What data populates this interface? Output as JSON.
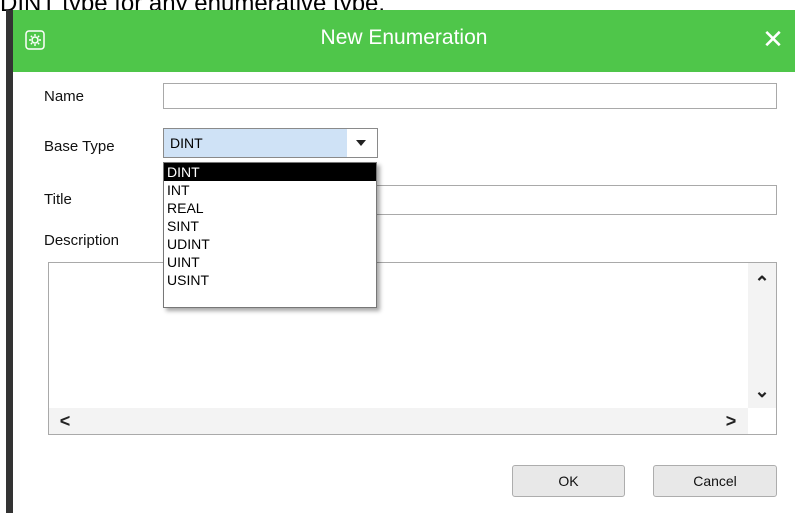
{
  "caption": "DINT type for any enumerative type.",
  "dialog": {
    "title": "New Enumeration",
    "close_glyph": "✕",
    "icon": "app-gear-icon",
    "accent_color": "#4fc64a"
  },
  "form": {
    "name_label": "Name",
    "name_value": "",
    "base_type_label": "Base Type",
    "base_type_value": "DINT",
    "title_label": "Title",
    "title_value": "",
    "description_label": "Description",
    "description_value": ""
  },
  "dropdown": {
    "options": [
      "DINT",
      "INT",
      "REAL",
      "SINT",
      "UDINT",
      "UINT",
      "USINT"
    ],
    "selected": "DINT"
  },
  "scrollbars": {
    "up": "⌃",
    "down": "⌄",
    "left": "<",
    "right": ">"
  },
  "buttons": {
    "ok_label": "OK",
    "cancel_label": "Cancel"
  }
}
